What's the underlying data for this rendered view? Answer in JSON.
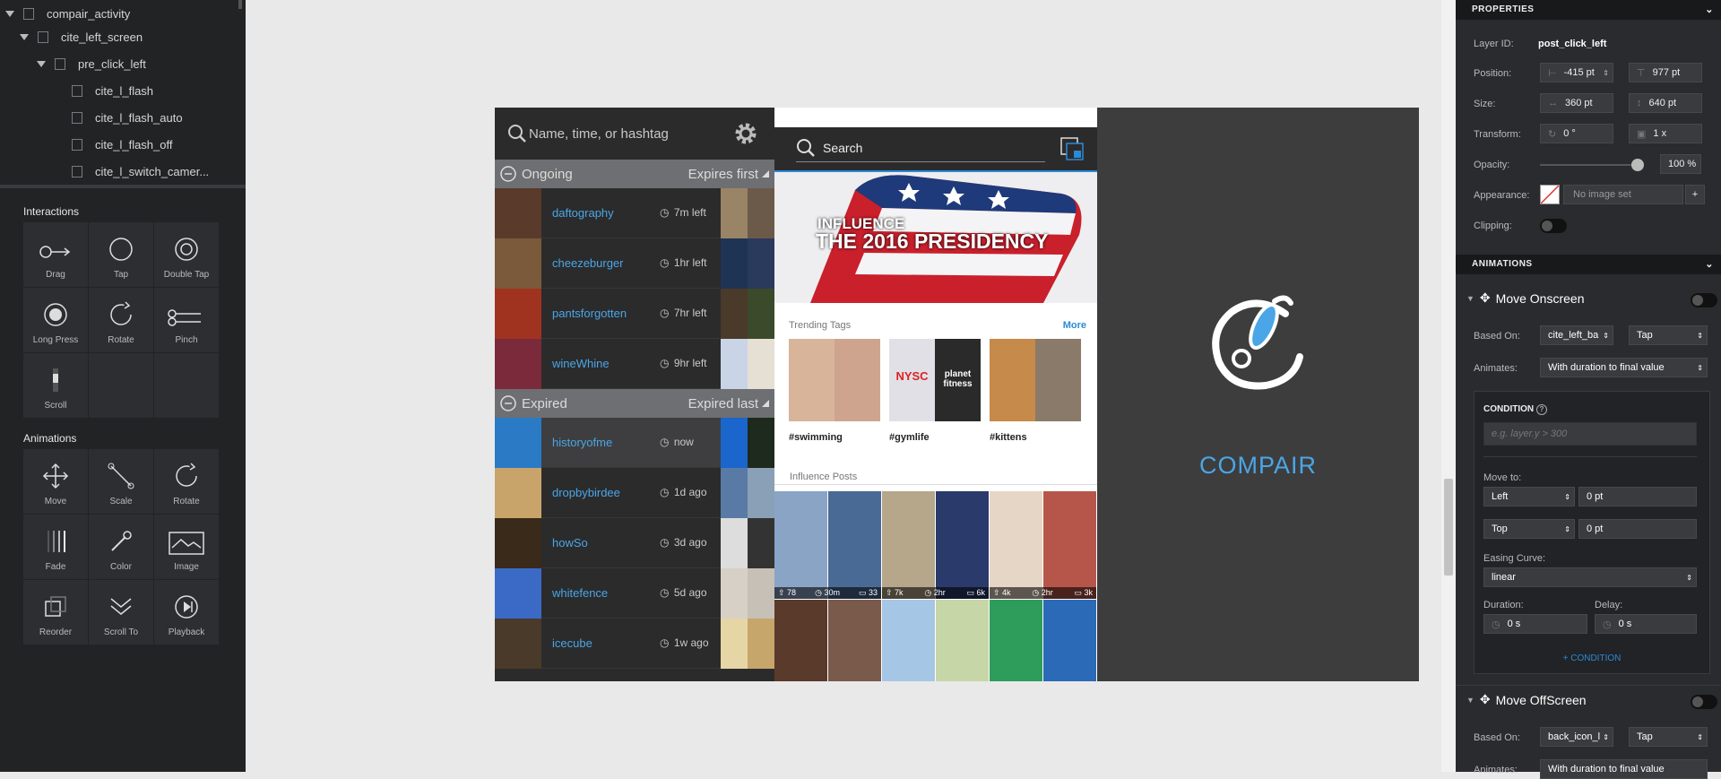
{
  "layers": [
    {
      "label": "compair_activity"
    },
    {
      "label": "cite_left_screen"
    },
    {
      "label": "pre_click_left"
    },
    {
      "label": "cite_l_flash"
    },
    {
      "label": "cite_l_flash_auto"
    },
    {
      "label": "cite_l_flash_off"
    },
    {
      "label": "cite_l_switch_camer..."
    }
  ],
  "interactions": {
    "title": "Interactions",
    "items": [
      {
        "label": "Drag"
      },
      {
        "label": "Tap"
      },
      {
        "label": "Double Tap"
      },
      {
        "label": "Long Press"
      },
      {
        "label": "Rotate"
      },
      {
        "label": "Pinch"
      },
      {
        "label": "Scroll"
      }
    ]
  },
  "animations_palette": {
    "title": "Animations",
    "items": [
      {
        "label": "Move"
      },
      {
        "label": "Scale"
      },
      {
        "label": "Rotate"
      },
      {
        "label": "Fade"
      },
      {
        "label": "Color"
      },
      {
        "label": "Image"
      },
      {
        "label": "Reorder"
      },
      {
        "label": "Scroll To"
      },
      {
        "label": "Playback"
      }
    ]
  },
  "properties": {
    "header": "PROPERTIES",
    "layer_id_label": "Layer ID:",
    "layer_id": "post_click_left",
    "position_label": "Position:",
    "pos_x": "-415 pt",
    "pos_y": "977 pt",
    "size_label": "Size:",
    "width": "360 pt",
    "height": "640 pt",
    "transform_label": "Transform:",
    "rotation": "0 °",
    "scale": "1 x",
    "opacity_label": "Opacity:",
    "opacity": "100 %",
    "opacity_fraction": 1.0,
    "appearance_label": "Appearance:",
    "appearance_value": "No image set",
    "clipping_label": "Clipping:"
  },
  "animations": {
    "header": "ANIMATIONS",
    "move_onscreen": {
      "title": "Move Onscreen",
      "based_on_label": "Based On:",
      "based_on": "cite_left_ba",
      "trigger": "Tap",
      "animates_label": "Animates:",
      "animates": "With duration to final value",
      "condition_title": "CONDITION",
      "condition_placeholder": "e.g. layer.y > 300",
      "move_to_label": "Move to:",
      "move_x_dir": "Left",
      "move_x_val": "0 pt",
      "move_y_dir": "Top",
      "move_y_val": "0 pt",
      "easing_label": "Easing Curve:",
      "easing": "linear",
      "duration_label": "Duration:",
      "duration": "0 s",
      "delay_label": "Delay:",
      "delay": "0 s",
      "add_condition": "+ CONDITION"
    },
    "move_offscreen": {
      "title": "Move OffScreen",
      "based_on_label": "Based On:",
      "based_on": "back_icon_l",
      "trigger": "Tap",
      "animates_label": "Animates:",
      "animates": "With duration to final value"
    }
  },
  "left_app": {
    "search_placeholder": "Name, time, or hashtag",
    "ongoing": {
      "label": "Ongoing",
      "sort": "Expires first"
    },
    "ongoing_rows": [
      {
        "name": "daftography",
        "time": "7m left",
        "av": "#5a3a2a",
        "t1": "#9a8466",
        "t2": "#6b5a4a"
      },
      {
        "name": "cheezeburger",
        "time": "1hr left",
        "av": "#7a5a3a",
        "t1": "#1f3355",
        "t2": "#2a3a5c"
      },
      {
        "name": "pantsforgotten",
        "time": "7hr left",
        "av": "#a0331f",
        "t1": "#4a3a2a",
        "t2": "#3a4a2a"
      },
      {
        "name": "wineWhine",
        "time": "9hr left",
        "av": "#7a2a3a",
        "t1": "#c9d4e6",
        "t2": "#e6e0d4"
      }
    ],
    "expired": {
      "label": "Expired",
      "sort": "Expired last"
    },
    "expired_rows": [
      {
        "name": "historyofme",
        "time": "now",
        "av": "#2a7ac6",
        "t1": "#1a66cc",
        "t2": "#1d2a1d",
        "hl": true
      },
      {
        "name": "dropbybirdee",
        "time": "1d ago",
        "av": "#c9a46a",
        "t1": "#5a7aa6",
        "t2": "#8aa0b6"
      },
      {
        "name": "howSo",
        "time": "3d ago",
        "av": "#3a2a1a",
        "t1": "#ddd",
        "t2": "#333"
      },
      {
        "name": "whitefence",
        "time": "5d ago",
        "av": "#3a6ac6",
        "t1": "#d6d0c6",
        "t2": "#c6c0b6"
      },
      {
        "name": "icecube",
        "time": "1w ago",
        "av": "#4a3a2a",
        "t1": "#e6d6a6",
        "t2": "#c6a66a"
      }
    ]
  },
  "search_app": {
    "search_label": "Search",
    "hero_line1": "INFLUENCE",
    "hero_line2": "THE 2016 PRESIDENCY",
    "trending_label": "Trending Tags",
    "more_label": "More",
    "tags": [
      {
        "label": "#swimming",
        "c1": "#d8b49a",
        "c2": "#cfa48e"
      },
      {
        "label": "#gymlife",
        "c1": "#e0e0e6",
        "c2": "#2a2a2a",
        "logo1": "NYSC",
        "logo2": "planet fitness"
      },
      {
        "label": "#kittens",
        "c1": "#c68a4a",
        "c2": "#8a7a6a"
      }
    ],
    "influence_label": "Influence Posts",
    "posts": [
      {
        "c1": "#8aa4c6",
        "c2": "#4a6a96",
        "stats": [
          "78",
          "30m",
          "33"
        ]
      },
      {
        "c1": "#b6a68a",
        "c2": "#2a3a6a",
        "stats": [
          "7k",
          "2hr",
          "6k"
        ]
      },
      {
        "c1": "#e6d6c6",
        "c2": "#b6564a",
        "stats": [
          "4k",
          "2hr",
          "3k"
        ]
      },
      {
        "c1": "#5a3a2a",
        "c2": "#7a5a4a",
        "stats": []
      },
      {
        "c1": "#a6c6e6",
        "c2": "#c6d6a6",
        "stats": []
      },
      {
        "c1": "#2e9c5a",
        "c2": "#2a6ab6",
        "stats": []
      }
    ]
  },
  "splash": {
    "brand": "COMPAIR"
  },
  "colors": {
    "accent": "#4aa6e6",
    "panel": "#2a2b2e",
    "link": "#2b8ad6"
  }
}
